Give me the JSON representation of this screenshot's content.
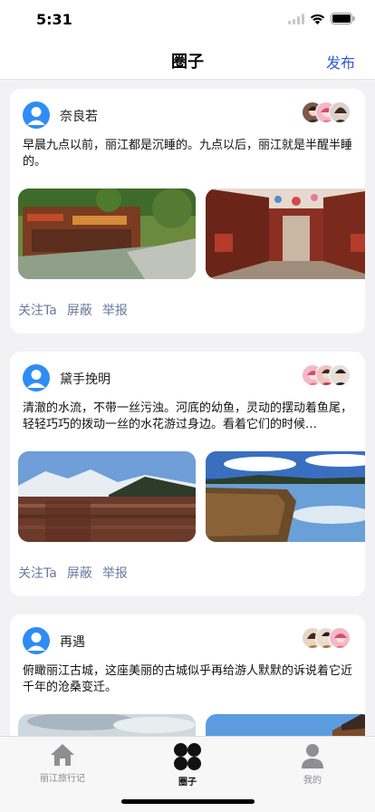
{
  "status_bar": {
    "time": "5:31"
  },
  "nav": {
    "title": "圈子",
    "action": "发布"
  },
  "posts": [
    {
      "user": "奈良若",
      "text": "早晨九点以前，丽江都是沉睡的。九点以后，丽江就是半醒半睡的。",
      "actions": [
        "关注Ta",
        "屏蔽",
        "举报"
      ]
    },
    {
      "user": "黛手挽明",
      "text": "清澈的水流，不带一丝污浊。河底的幼鱼，灵动的摆动着鱼尾，轻轻巧巧的拨动一丝的水花游过身边。看着它们的时候…",
      "actions": [
        "关注Ta",
        "屏蔽",
        "举报"
      ]
    },
    {
      "user": "再遇",
      "text": "俯瞰丽江古城，这座美丽的古城似乎再给游人默默的诉说着它近千年的沧桑变迁。",
      "actions": []
    }
  ],
  "tabs": [
    {
      "label": "丽江旅行记",
      "icon": "home-icon"
    },
    {
      "label": "圈子",
      "icon": "circle-grid-icon"
    },
    {
      "label": "我的",
      "icon": "person-icon"
    }
  ],
  "colors": {
    "accent": "#2a5bd7",
    "avatar": "#2f8cf5",
    "action_text": "#6a7a9c",
    "background": "#f2f2f4"
  }
}
